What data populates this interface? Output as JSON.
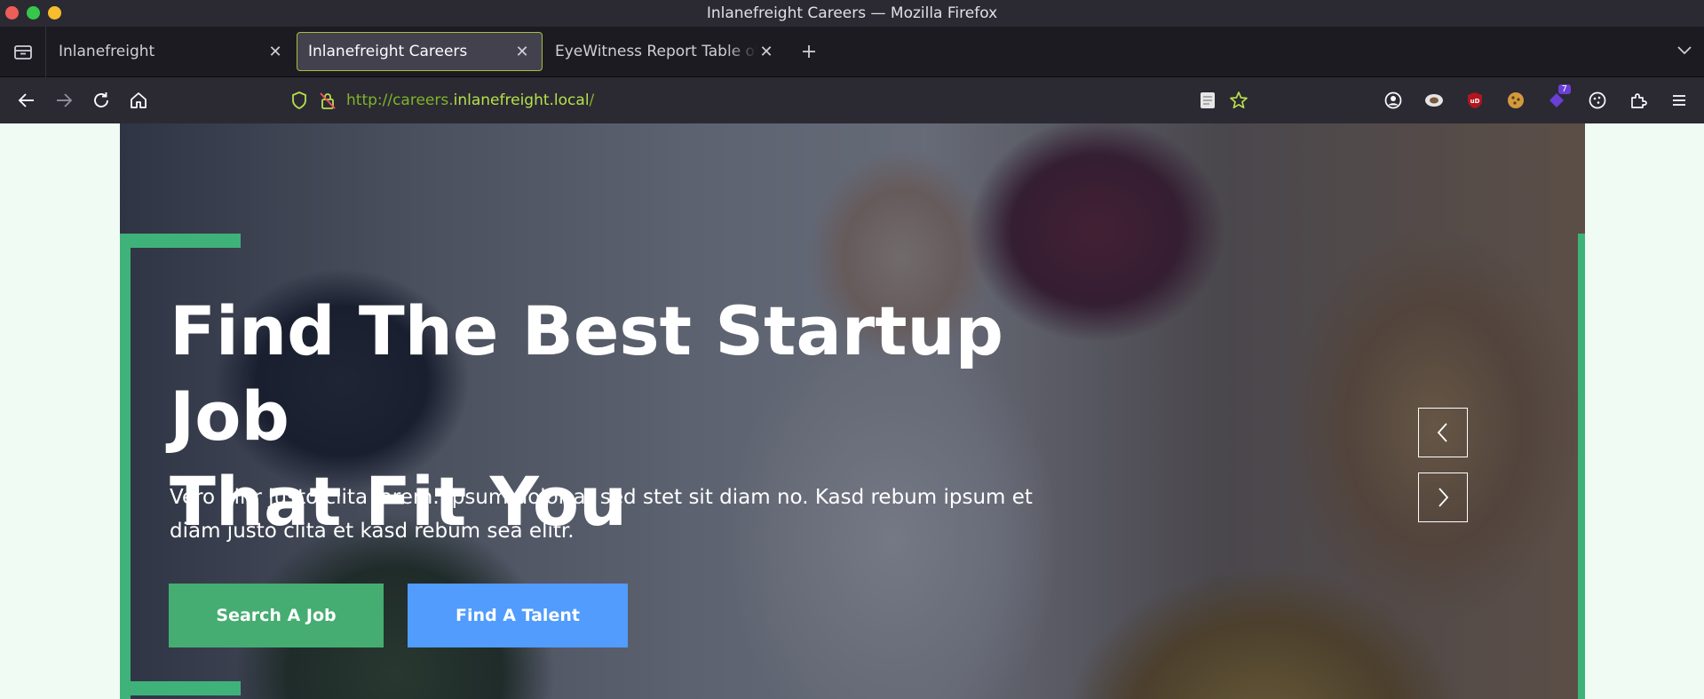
{
  "window": {
    "title": "Inlanefreight Careers — Mozilla Firefox"
  },
  "tabs": [
    {
      "label": "Inlanefreight",
      "active": false
    },
    {
      "label": "Inlanefreight Careers",
      "active": true
    },
    {
      "label": "EyeWitness Report Table of Contents",
      "active": false
    }
  ],
  "urlbar": {
    "scheme": "http://careers.",
    "domain": "inlanefreight.local",
    "path": "/"
  },
  "extensions": {
    "badge_count": "7"
  },
  "hero": {
    "title_line1": "Find The Best Startup Job",
    "title_line2": "That Fit You",
    "subtitle": "Vero elitr justo clita lorem. Ipsum dolor at sed stet sit diam no. Kasd rebum ipsum et diam justo clita et kasd rebum sea elitr.",
    "search_button": "Search A Job",
    "talent_button": "Find A Talent"
  },
  "colors": {
    "accent_green": "#3fb27a",
    "button_green": "#45ad72",
    "button_blue": "#519cfd",
    "tab_active_border": "#a4c13e"
  },
  "icons": [
    "tab-list-icon",
    "back-arrow-icon",
    "forward-arrow-icon",
    "reload-icon",
    "home-icon",
    "shield-icon",
    "lock-icon",
    "reader-icon",
    "bookmark-star-icon",
    "account-icon",
    "extension-icons",
    "puzzle-icon",
    "menu-icon",
    "chevron-left-icon",
    "chevron-right-icon"
  ]
}
